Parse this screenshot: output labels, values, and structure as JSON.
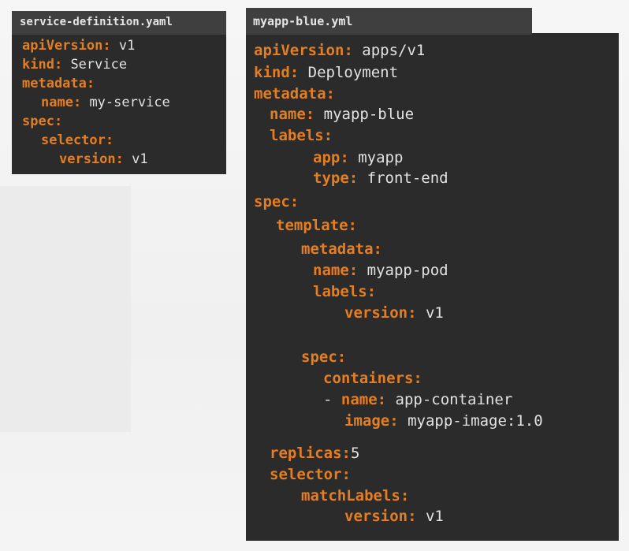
{
  "service_file": {
    "title": "service-definition.yaml",
    "lines": [
      {
        "key": "apiVersion:",
        "value": "v1"
      },
      {
        "key": "kind:",
        "value": "Service"
      },
      {
        "key": "metadata:",
        "value": ""
      },
      {
        "key": "name:",
        "value": "my-service"
      },
      {
        "key": "spec:",
        "value": ""
      },
      {
        "key": "selector:",
        "value": ""
      },
      {
        "key": "version:",
        "value": "v1"
      }
    ]
  },
  "deployment_file": {
    "title": "myapp-blue.yml",
    "lines": [
      {
        "key": "apiVersion:",
        "value": "apps/v1"
      },
      {
        "key": "kind:",
        "value": "Deployment"
      },
      {
        "key": "metadata:",
        "value": ""
      },
      {
        "key": "name:",
        "value": "myapp-blue"
      },
      {
        "key": "labels:",
        "value": ""
      },
      {
        "key": "app:",
        "value": "myapp"
      },
      {
        "key": "type:",
        "value": "front-end"
      },
      {
        "key": "spec:",
        "value": ""
      },
      {
        "key": "template:",
        "value": ""
      },
      {
        "key": "metadata:",
        "value": ""
      },
      {
        "key": "name:",
        "value": "myapp-pod"
      },
      {
        "key": "labels:",
        "value": ""
      },
      {
        "key": "version:",
        "value": "v1"
      },
      {
        "key": "spec:",
        "value": ""
      },
      {
        "key": "containers:",
        "value": ""
      },
      {
        "dash": "- ",
        "key": "name:",
        "value": "app-container"
      },
      {
        "key": "image:",
        "value": "myapp-image:1.0"
      },
      {
        "key": "replicas:",
        "value": "5"
      },
      {
        "key": "selector:",
        "value": ""
      },
      {
        "key": "matchLabels:",
        "value": ""
      },
      {
        "key": "version:",
        "value": "v1"
      }
    ]
  }
}
